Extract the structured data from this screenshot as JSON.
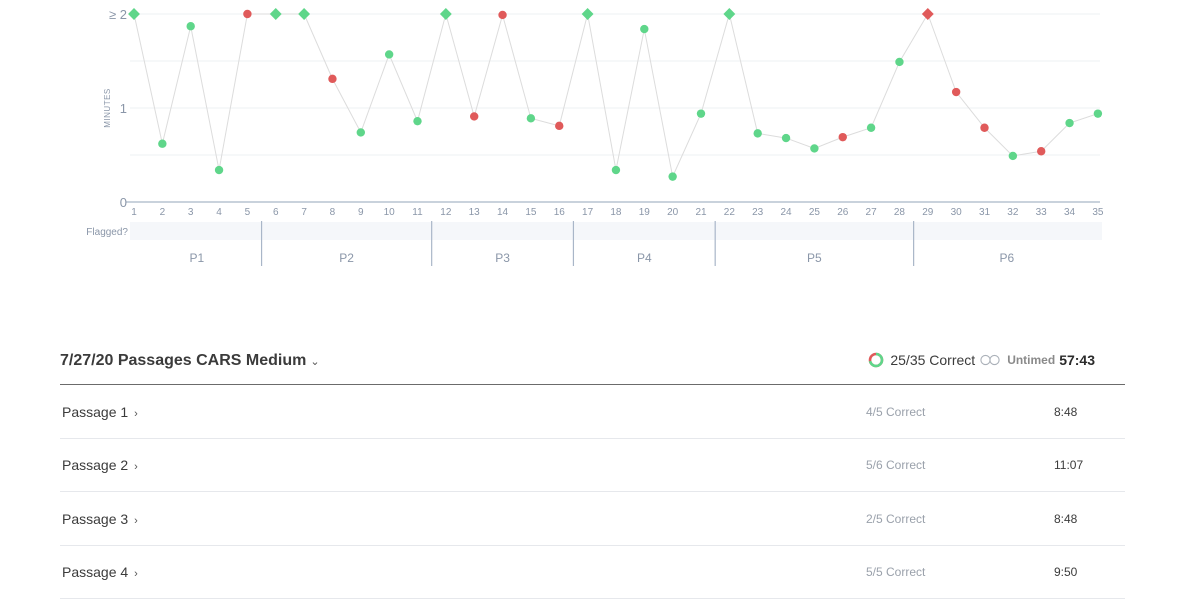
{
  "chart_data": {
    "type": "scatter",
    "ylabel": "MINUTES",
    "y_ticks": [
      "0",
      "1",
      "≥ 2"
    ],
    "ylim": [
      0,
      2
    ],
    "x": [
      1,
      2,
      3,
      4,
      5,
      6,
      7,
      8,
      9,
      10,
      11,
      12,
      13,
      14,
      15,
      16,
      17,
      18,
      19,
      20,
      21,
      22,
      23,
      24,
      25,
      26,
      27,
      28,
      29,
      30,
      31,
      32,
      33,
      34,
      35
    ],
    "values": [
      2.0,
      0.62,
      1.87,
      0.34,
      2.0,
      2.0,
      2.0,
      1.31,
      0.74,
      1.57,
      0.86,
      2.0,
      0.91,
      1.99,
      0.89,
      0.81,
      2.0,
      0.34,
      1.84,
      0.27,
      0.94,
      2.0,
      0.73,
      0.68,
      0.57,
      0.69,
      0.79,
      1.49,
      2.0,
      1.17,
      0.79,
      0.49,
      0.54,
      0.84,
      0.94
    ],
    "correct": [
      true,
      true,
      true,
      true,
      false,
      true,
      true,
      false,
      true,
      true,
      true,
      true,
      false,
      false,
      true,
      false,
      true,
      true,
      true,
      true,
      true,
      true,
      true,
      true,
      true,
      false,
      true,
      true,
      false,
      false,
      false,
      true,
      false,
      true,
      true
    ],
    "capped": [
      true,
      false,
      false,
      false,
      false,
      true,
      true,
      false,
      false,
      false,
      false,
      true,
      false,
      false,
      false,
      false,
      true,
      false,
      false,
      false,
      false,
      true,
      false,
      false,
      false,
      false,
      false,
      false,
      true,
      false,
      false,
      false,
      false,
      false,
      false
    ],
    "flag_label": "Flagged?",
    "passages": [
      {
        "label": "P1",
        "from": 1,
        "to": 5
      },
      {
        "label": "P2",
        "from": 6,
        "to": 11
      },
      {
        "label": "P3",
        "from": 12,
        "to": 16
      },
      {
        "label": "P4",
        "from": 17,
        "to": 21
      },
      {
        "label": "P5",
        "from": 22,
        "to": 28
      },
      {
        "label": "P6",
        "from": 29,
        "to": 35
      }
    ],
    "grid": true,
    "colors": {
      "correct": "#5fd68a",
      "incorrect": "#e05a5a",
      "line": "#dcdcdc",
      "axis": "#a9b6c8",
      "grid": "#eef0f3",
      "flag_band": "#f5f7fa"
    }
  },
  "summary": {
    "title": "7/27/20 Passages CARS Medium",
    "caret_icon": "⌄",
    "score": "25/35 Correct",
    "score_fraction": 0.714,
    "untimed_label": "Untimed",
    "total_time": "57:43"
  },
  "passages_list": [
    {
      "name": "Passage 1",
      "score": "4/5 Correct",
      "time": "8:48"
    },
    {
      "name": "Passage 2",
      "score": "5/6 Correct",
      "time": "11:07"
    },
    {
      "name": "Passage 3",
      "score": "2/5 Correct",
      "time": "8:48"
    },
    {
      "name": "Passage 4",
      "score": "5/5 Correct",
      "time": "9:50"
    }
  ],
  "chevron_icon": "›"
}
